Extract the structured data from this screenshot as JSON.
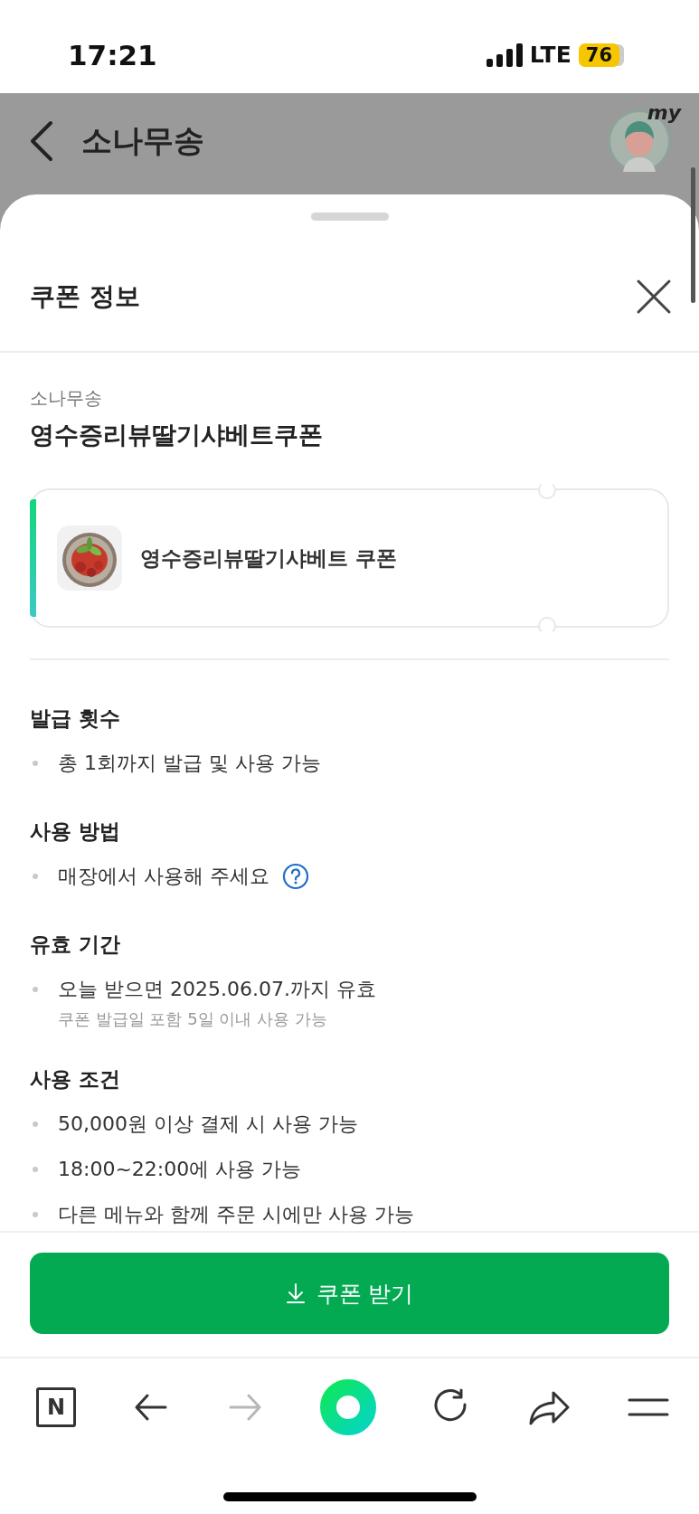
{
  "status_bar": {
    "time": "17:21",
    "network": "LTE",
    "battery": "76"
  },
  "header": {
    "title": "소나무송",
    "avatar_badge": "my"
  },
  "sheet": {
    "title": "쿠폰 정보"
  },
  "coupon": {
    "store": "소나무송",
    "name": "영수증리뷰딸기샤베트쿠폰",
    "card_label": "영수증리뷰딸기샤베트 쿠폰"
  },
  "sections": [
    {
      "heading": "발급 횟수",
      "items": [
        {
          "text": "총 1회까지 발급 및 사용 가능",
          "help": false
        }
      ]
    },
    {
      "heading": "사용 방법",
      "items": [
        {
          "text": "매장에서 사용해 주세요",
          "help": true
        }
      ]
    },
    {
      "heading": "유효 기간",
      "items": [
        {
          "text": "오늘 받으면 2025.06.07.까지 유효",
          "help": false,
          "note": "쿠폰 발급일 포함 5일 이내 사용 가능"
        }
      ]
    },
    {
      "heading": "사용 조건",
      "items": [
        {
          "text": "50,000원 이상 결제 시 사용 가능",
          "help": false
        },
        {
          "text": "18:00~22:00에 사용 가능",
          "help": false
        },
        {
          "text": "다른 메뉴와 함께 주문 시에만 사용 가능",
          "help": false
        }
      ]
    }
  ],
  "button": {
    "label": "쿠폰 받기"
  },
  "toolbar": {
    "logo": "N",
    "items": [
      {
        "kind": "back",
        "disabled": false
      },
      {
        "kind": "forward",
        "disabled": true
      },
      {
        "kind": "home",
        "disabled": false
      },
      {
        "kind": "reload",
        "disabled": false
      },
      {
        "kind": "share",
        "disabled": false
      },
      {
        "kind": "menu",
        "disabled": false
      }
    ]
  }
}
